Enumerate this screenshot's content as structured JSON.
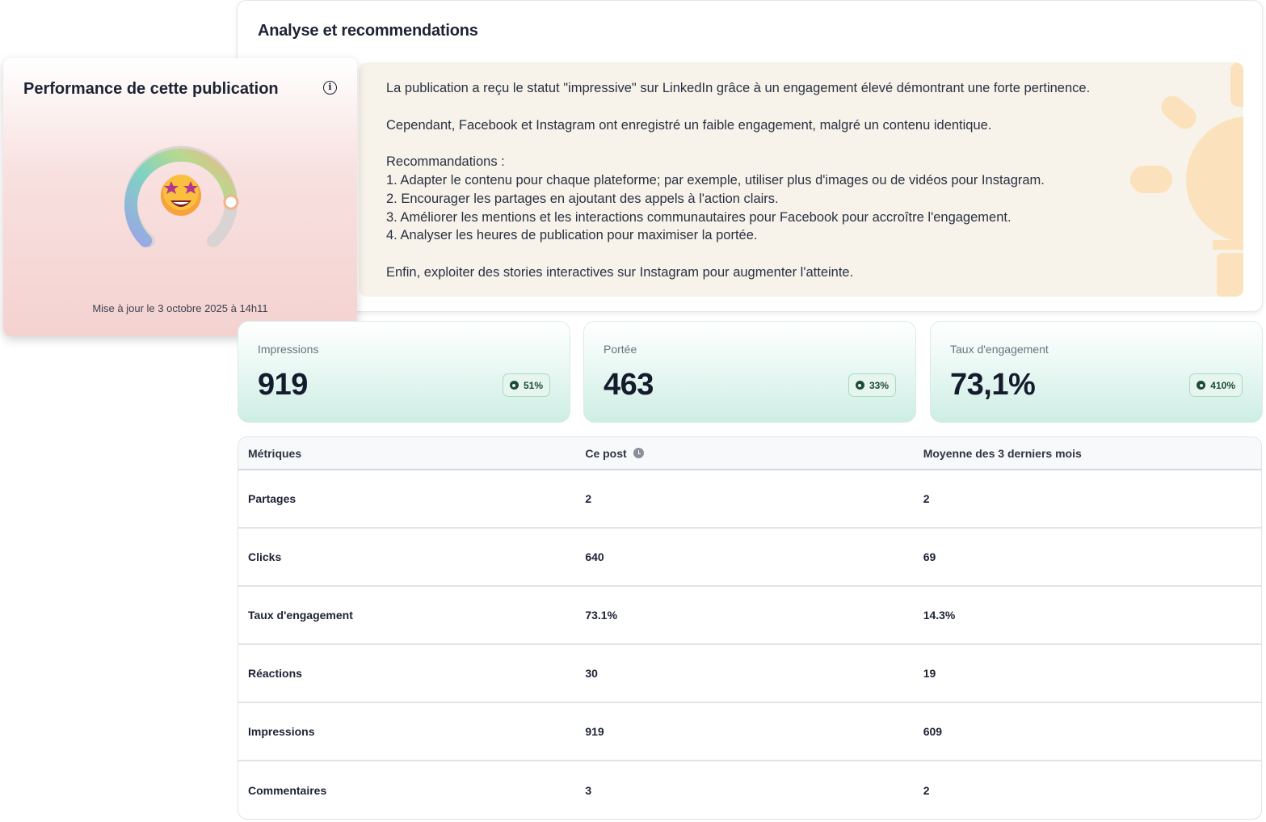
{
  "analysis": {
    "title": "Analyse et recommendations",
    "paragraphs": [
      "La publication a reçu le statut \"impressive\" sur LinkedIn grâce à un engagement élevé démontrant une forte pertinence.",
      "Cependant, Facebook et Instagram ont enregistré un faible engagement, malgré un contenu identique.",
      "Recommandations :\n1. Adapter le contenu pour chaque plateforme; par exemple, utiliser plus d'images ou de vidéos pour Instagram.\n2. Encourager les partages en ajoutant des appels à l'action clairs.\n3. Améliorer les mentions et les interactions communautaires pour Facebook pour accroître l'engagement.\n4. Analyser les heures de publication pour maximiser la portée.",
      "Enfin, exploiter des stories interactives sur Instagram pour augmenter l'atteinte."
    ],
    "decor_icon": "lightbulb-icon"
  },
  "performance": {
    "title": "Performance de cette publication",
    "info_icon": "i",
    "gauge_level": 0.82,
    "emoji_icon": "star-struck-emoji-icon",
    "updated": "Mise à jour le 3 octobre 2025 à 14h11"
  },
  "kpis": [
    {
      "label": "Impressions",
      "value": "919",
      "badge": "51%"
    },
    {
      "label": "Portée",
      "value": "463",
      "badge": "33%"
    },
    {
      "label": "Taux d'engagement",
      "value": "73,1%",
      "badge": "410%"
    }
  ],
  "table": {
    "headers": [
      "Métriques",
      "Ce post",
      "Moyenne des 3 derniers mois"
    ],
    "rows": [
      [
        "Partages",
        "2",
        "2"
      ],
      [
        "Clicks",
        "640",
        "69"
      ],
      [
        "Taux d'engagement",
        "73.1%",
        "14.3%"
      ],
      [
        "Réactions",
        "30",
        "19"
      ],
      [
        "Impressions",
        "919",
        "609"
      ],
      [
        "Commentaires",
        "3",
        "2"
      ]
    ]
  },
  "colors": {
    "accent_green": "#1f4a3a",
    "analysis_bg": "#f7f3ea",
    "perf_bg": "#f4d2d0"
  }
}
